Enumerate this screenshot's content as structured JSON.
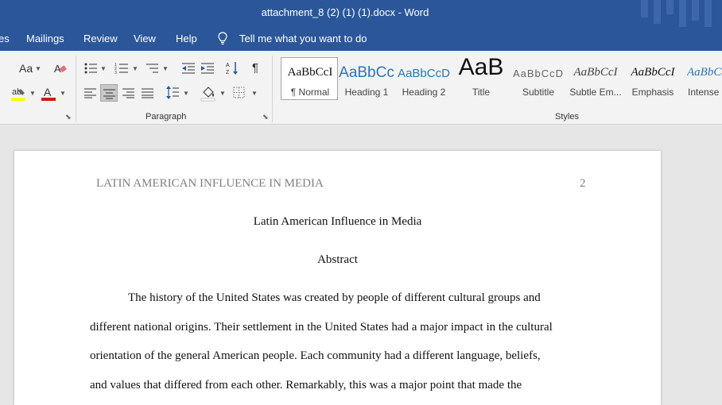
{
  "window": {
    "title": "attachment_8 (2) (1) (1).docx  -  Word"
  },
  "menu": {
    "items": [
      "es",
      "Mailings",
      "Review",
      "View",
      "Help"
    ],
    "tell_me": "Tell me what you want to do"
  },
  "ribbon": {
    "font_group": {
      "change_case": "Aa"
    },
    "paragraph_group": {
      "label": "Paragraph"
    },
    "styles_group": {
      "label": "Styles",
      "styles": [
        {
          "sample": "AaBbCcI",
          "name": "¶ Normal"
        },
        {
          "sample": "AaBbCc",
          "name": "Heading 1"
        },
        {
          "sample": "AaBbCcD",
          "name": "Heading 2"
        },
        {
          "sample": "AaB",
          "name": "Title"
        },
        {
          "sample": "AaBbCcD",
          "name": "Subtitle"
        },
        {
          "sample": "AaBbCcI",
          "name": "Subtle Em..."
        },
        {
          "sample": "AaBbCcI",
          "name": "Emphasis"
        },
        {
          "sample": "AaBbCcI",
          "name": "Intense E"
        }
      ]
    }
  },
  "document": {
    "running_head": "LATIN AMERICAN INFLUENCE IN MEDIA",
    "page_number": "2",
    "title": "Latin American Influence in Media",
    "section_heading": "Abstract",
    "lines": [
      "The history of the United States was created by people of different cultural groups and",
      "different national origins. Their settlement in the United States had a major impact in the cultural",
      "orientation of the general American people. Each community had a different language, beliefs,",
      "and values that differed from each other. Remarkably, this was a major point that made the"
    ]
  },
  "colors": {
    "titlebar": "#2b579a",
    "ribbon": "#f3f3f3",
    "canvas": "#e6e6e6",
    "heading1": "#2e74b5"
  }
}
